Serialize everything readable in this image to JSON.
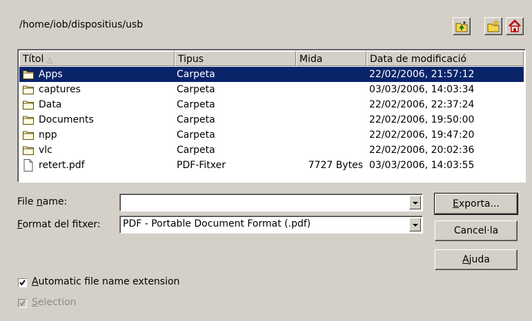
{
  "path": "/home/iob/dispositius/usb",
  "toolbar": {
    "up_icon": "folder-up-icon",
    "new_folder_icon": "new-folder-icon",
    "home_icon": "home-icon"
  },
  "columns": [
    "Títol",
    "Tipus",
    "Mida",
    "Data de modificació"
  ],
  "sort_indicator": "△",
  "files": [
    {
      "name": "Apps",
      "type": "Carpeta",
      "size": "",
      "date": "22/02/2006, 21:57:12",
      "icon": "folder-icon",
      "selected": true
    },
    {
      "name": "captures",
      "type": "Carpeta",
      "size": "",
      "date": "03/03/2006, 14:03:34",
      "icon": "folder-icon"
    },
    {
      "name": "Data",
      "type": "Carpeta",
      "size": "",
      "date": "22/02/2006, 22:37:24",
      "icon": "folder-icon"
    },
    {
      "name": "Documents",
      "type": "Carpeta",
      "size": "",
      "date": "22/02/2006, 19:50:00",
      "icon": "folder-icon"
    },
    {
      "name": "npp",
      "type": "Carpeta",
      "size": "",
      "date": "22/02/2006, 19:47:20",
      "icon": "folder-icon"
    },
    {
      "name": "vlc",
      "type": "Carpeta",
      "size": "",
      "date": "22/02/2006, 20:02:36",
      "icon": "folder-icon"
    },
    {
      "name": "retert.pdf",
      "type": "PDF-Fitxer",
      "size": "7727 Bytes",
      "date": "03/03/2006, 14:03:55",
      "icon": "file-icon"
    }
  ],
  "file_name": {
    "pre": "File ",
    "acc": "n",
    "post": "ame:",
    "value": ""
  },
  "format": {
    "acc": "F",
    "post": "ormat del fitxer:",
    "value": "PDF - Portable Document Format (.pdf)"
  },
  "buttons": {
    "export": {
      "acc": "E",
      "post": "xporta..."
    },
    "cancel": "Cancel·la",
    "help": {
      "acc": "A",
      "post": "juda"
    }
  },
  "checkboxes": {
    "auto_ext": {
      "acc": "A",
      "post": "utomatic file name extension",
      "checked": true
    },
    "selection": {
      "acc": "S",
      "post": "election",
      "checked": true,
      "disabled": true
    }
  },
  "colors": {
    "selection": "#0a246a",
    "face": "#d4d0c8"
  }
}
